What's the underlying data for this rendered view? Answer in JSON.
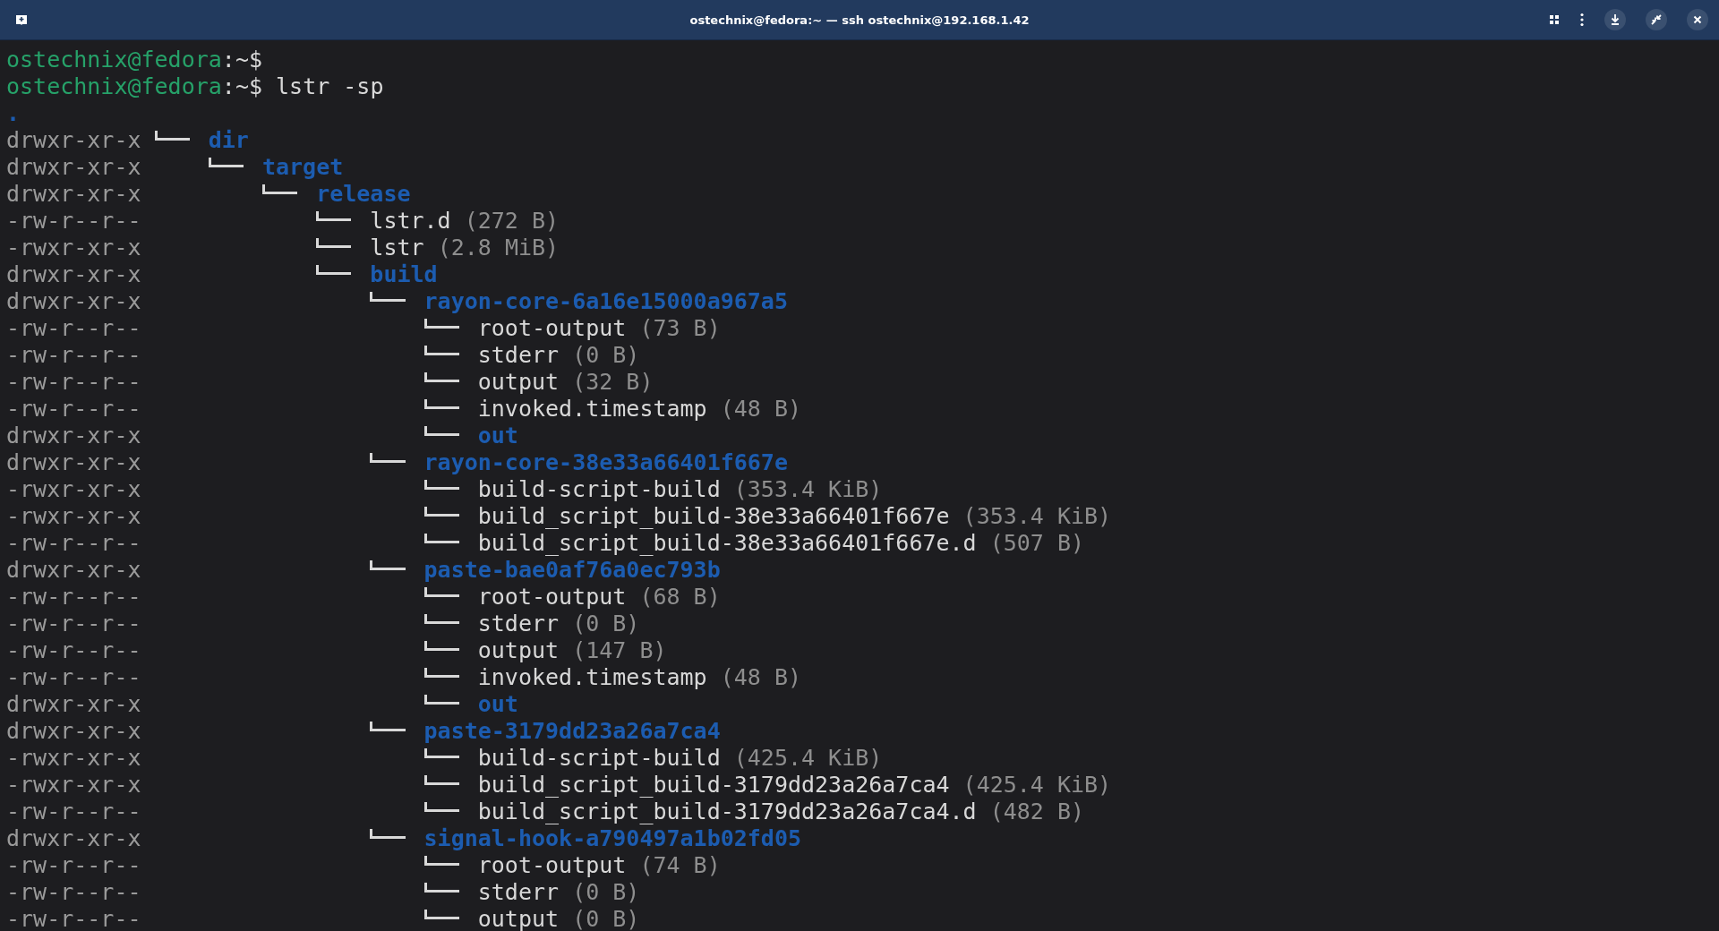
{
  "window": {
    "title": "ostechnix@fedora:~ — ssh ostechnix@192.168.1.42"
  },
  "prompts": [
    {
      "user_host": "ostechnix@fedora",
      "path": ":~$"
    },
    {
      "user_host": "ostechnix@fedora",
      "path": ":~$",
      "command": "lstr -sp"
    }
  ],
  "tree": {
    "name": ".",
    "kind": "dir",
    "children": [
      {
        "permissions": "drwxr-xr-x",
        "name": "dir",
        "kind": "dir",
        "children": [
          {
            "permissions": "drwxr-xr-x",
            "name": "target",
            "kind": "dir",
            "children": [
              {
                "permissions": "drwxr-xr-x",
                "name": "release",
                "kind": "dir",
                "children": [
                  {
                    "permissions": "-rw-r--r--",
                    "name": "lstr.d",
                    "size": "(272 B)",
                    "kind": "file"
                  },
                  {
                    "permissions": "-rwxr-xr-x",
                    "name": "lstr",
                    "size": "(2.8 MiB)",
                    "kind": "file"
                  },
                  {
                    "permissions": "drwxr-xr-x",
                    "name": "build",
                    "kind": "dir",
                    "children": [
                      {
                        "permissions": "drwxr-xr-x",
                        "name": "rayon-core-6a16e15000a967a5",
                        "kind": "dir",
                        "children": [
                          {
                            "permissions": "-rw-r--r--",
                            "name": "root-output",
                            "size": "(73 B)",
                            "kind": "file"
                          },
                          {
                            "permissions": "-rw-r--r--",
                            "name": "stderr",
                            "size": "(0 B)",
                            "kind": "file"
                          },
                          {
                            "permissions": "-rw-r--r--",
                            "name": "output",
                            "size": "(32 B)",
                            "kind": "file"
                          },
                          {
                            "permissions": "-rw-r--r--",
                            "name": "invoked.timestamp",
                            "size": "(48 B)",
                            "kind": "file"
                          },
                          {
                            "permissions": "drwxr-xr-x",
                            "name": "out",
                            "kind": "dir"
                          }
                        ]
                      },
                      {
                        "permissions": "drwxr-xr-x",
                        "name": "rayon-core-38e33a66401f667e",
                        "kind": "dir",
                        "children": [
                          {
                            "permissions": "-rwxr-xr-x",
                            "name": "build-script-build",
                            "size": "(353.4 KiB)",
                            "kind": "file"
                          },
                          {
                            "permissions": "-rwxr-xr-x",
                            "name": "build_script_build-38e33a66401f667e",
                            "size": "(353.4 KiB)",
                            "kind": "file"
                          },
                          {
                            "permissions": "-rw-r--r--",
                            "name": "build_script_build-38e33a66401f667e.d",
                            "size": "(507 B)",
                            "kind": "file"
                          }
                        ]
                      },
                      {
                        "permissions": "drwxr-xr-x",
                        "name": "paste-bae0af76a0ec793b",
                        "kind": "dir",
                        "children": [
                          {
                            "permissions": "-rw-r--r--",
                            "name": "root-output",
                            "size": "(68 B)",
                            "kind": "file"
                          },
                          {
                            "permissions": "-rw-r--r--",
                            "name": "stderr",
                            "size": "(0 B)",
                            "kind": "file"
                          },
                          {
                            "permissions": "-rw-r--r--",
                            "name": "output",
                            "size": "(147 B)",
                            "kind": "file"
                          },
                          {
                            "permissions": "-rw-r--r--",
                            "name": "invoked.timestamp",
                            "size": "(48 B)",
                            "kind": "file"
                          },
                          {
                            "permissions": "drwxr-xr-x",
                            "name": "out",
                            "kind": "dir"
                          }
                        ]
                      },
                      {
                        "permissions": "drwxr-xr-x",
                        "name": "paste-3179dd23a26a7ca4",
                        "kind": "dir",
                        "children": [
                          {
                            "permissions": "-rwxr-xr-x",
                            "name": "build-script-build",
                            "size": "(425.4 KiB)",
                            "kind": "file"
                          },
                          {
                            "permissions": "-rwxr-xr-x",
                            "name": "build_script_build-3179dd23a26a7ca4",
                            "size": "(425.4 KiB)",
                            "kind": "file"
                          },
                          {
                            "permissions": "-rw-r--r--",
                            "name": "build_script_build-3179dd23a26a7ca4.d",
                            "size": "(482 B)",
                            "kind": "file"
                          }
                        ]
                      },
                      {
                        "permissions": "drwxr-xr-x",
                        "name": "signal-hook-a790497a1b02fd05",
                        "kind": "dir",
                        "children": [
                          {
                            "permissions": "-rw-r--r--",
                            "name": "root-output",
                            "size": "(74 B)",
                            "kind": "file"
                          },
                          {
                            "permissions": "-rw-r--r--",
                            "name": "stderr",
                            "size": "(0 B)",
                            "kind": "file"
                          },
                          {
                            "permissions": "-rw-r--r--",
                            "name": "output",
                            "size": "(0 B)",
                            "kind": "file"
                          }
                        ]
                      }
                    ]
                  }
                ]
              }
            ]
          }
        ]
      }
    ]
  }
}
